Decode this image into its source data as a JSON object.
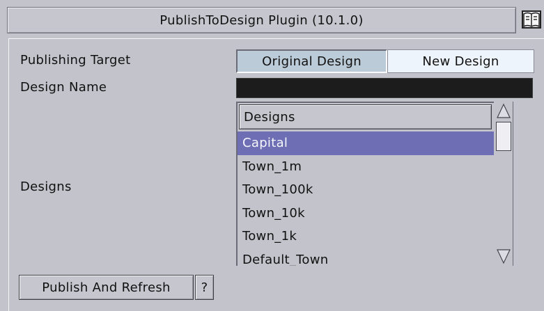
{
  "window": {
    "title": "PublishToDesign Plugin (10.1.0)",
    "help_icon": "help-book-icon"
  },
  "form": {
    "publishing_target_label": "Publishing Target",
    "target_options": [
      {
        "label": "Original Design",
        "selected": true
      },
      {
        "label": "New Design",
        "selected": false
      }
    ],
    "design_name_label": "Design Name",
    "design_name_value": "",
    "designs_label": "Designs"
  },
  "designs_list": {
    "header": "Designs",
    "items": [
      "Capital",
      "Town_1m",
      "Town_100k",
      "Town_10k",
      "Town_1k",
      "Default_Town"
    ],
    "selected": "Capital"
  },
  "scrollbar": {
    "up_icon": "scroll-up-arrow-icon",
    "down_icon": "scroll-down-arrow-icon"
  },
  "buttons": {
    "publish_label": "Publish And Refresh",
    "help_label": "?"
  },
  "colors": {
    "background": "#c3c3cb",
    "selection": "#6e6eb4",
    "target_selected": "#bccbd8",
    "target_unselected": "#eef4fb",
    "name_field": "#1c1c1c"
  }
}
